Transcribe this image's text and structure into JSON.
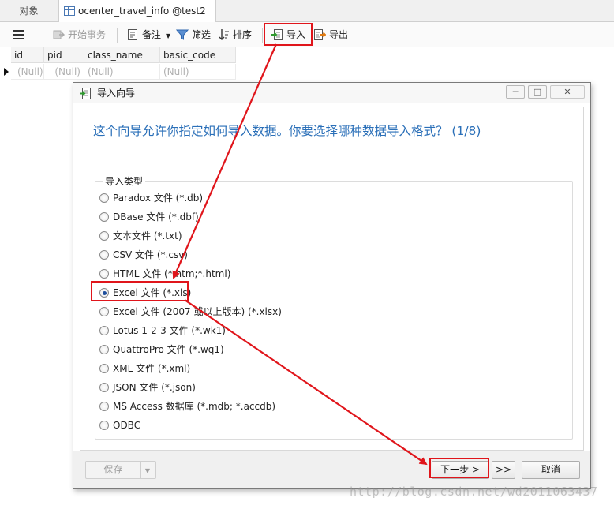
{
  "tabs": {
    "objects": "对象",
    "table": "ocenter_travel_info @test2 (l..."
  },
  "toolbar": {
    "begin_transaction": "开始事务",
    "memo": "备注",
    "filter": "筛选",
    "sort": "排序",
    "import": "导入",
    "export": "导出"
  },
  "grid": {
    "columns": [
      "id",
      "pid",
      "class_name",
      "basic_code"
    ],
    "row": [
      "(Null)",
      "(Null)",
      "(Null)",
      "(Null)"
    ]
  },
  "dialog": {
    "title": "导入向导",
    "heading": "这个向导允许你指定如何导入数据。你要选择哪种数据导入格式？ (1/8)",
    "group_label": "导入类型",
    "options": [
      "Paradox 文件 (*.db)",
      "DBase 文件 (*.dbf)",
      "文本文件 (*.txt)",
      "CSV 文件 (*.csv)",
      "HTML 文件 (*.htm;*.html)",
      "Excel 文件 (*.xls)",
      "Excel 文件 (2007 或以上版本) (*.xlsx)",
      "Lotus 1-2-3 文件 (*.wk1)",
      "QuattroPro 文件 (*.wq1)",
      "XML 文件 (*.xml)",
      "JSON 文件 (*.json)",
      "MS Access 数据库 (*.mdb; *.accdb)",
      "ODBC"
    ],
    "selected_option": "Excel 文件 (*.xls)",
    "buttons": {
      "save": "保存",
      "next": "下一步 >",
      "last": ">>",
      "cancel": "取消"
    }
  },
  "watermark": "http://blog.csdn.net/wd2011063437",
  "colors": {
    "highlight": "#e0151b",
    "heading": "#2a6fb8"
  }
}
